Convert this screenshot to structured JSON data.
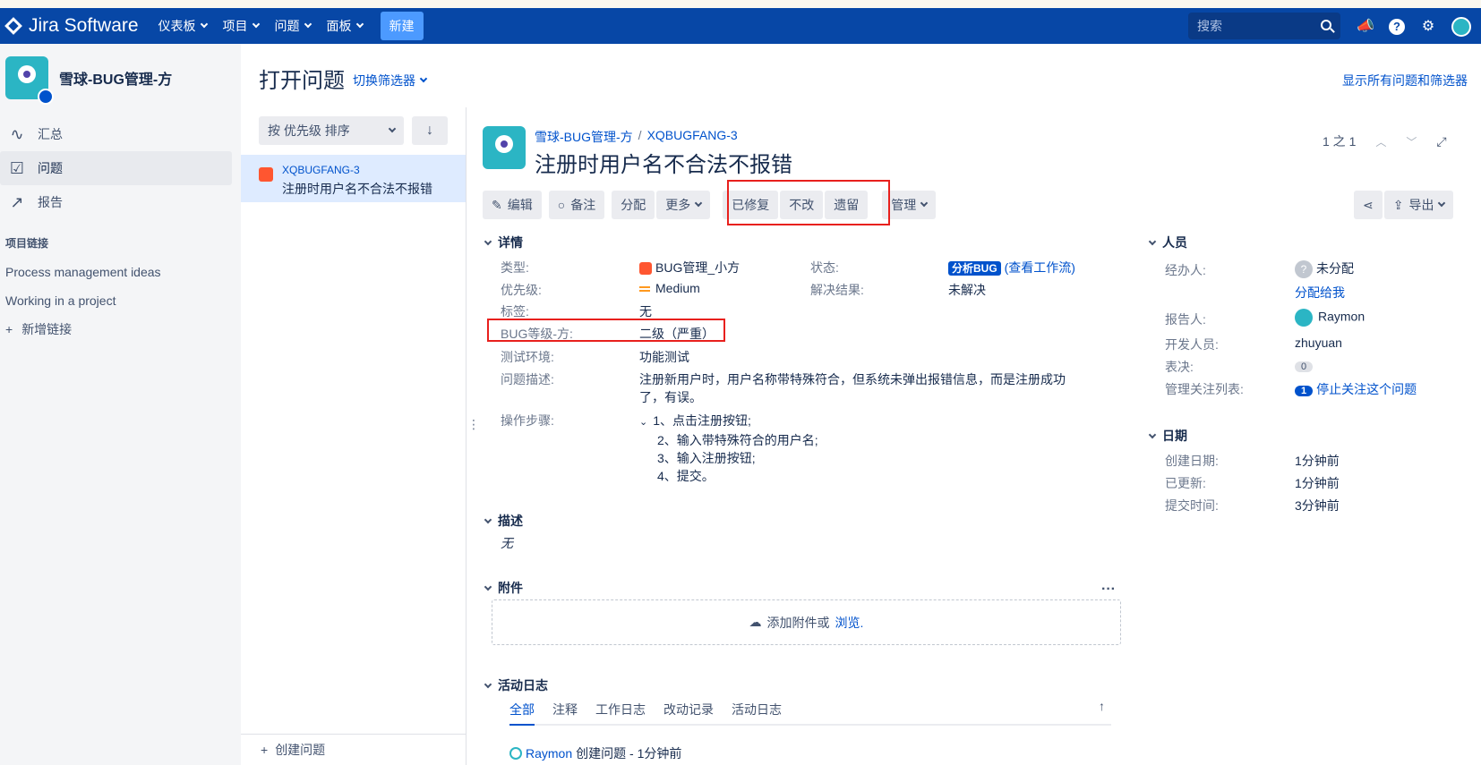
{
  "topbar": {
    "logo_text": "Jira Software",
    "menu": [
      "仪表板",
      "项目",
      "问题",
      "面板"
    ],
    "create_label": "新建",
    "search_placeholder": "搜索"
  },
  "sidebar": {
    "project_name": "雪球-BUG管理-方",
    "items": [
      {
        "label": "汇总",
        "icon": "pulse-icon"
      },
      {
        "label": "问题",
        "icon": "issues-icon"
      },
      {
        "label": "报告",
        "icon": "chart-icon"
      }
    ],
    "section_title": "项目链接",
    "links": [
      "Process management ideas",
      "Working in a project"
    ],
    "add_link": "新增链接"
  },
  "header": {
    "title": "打开问题",
    "switch_filter": "切换筛选器",
    "show_all": "显示所有问题和筛选器"
  },
  "list": {
    "sort_label": "按 优先级 排序",
    "sort_dir": "↓",
    "item_key": "XQBUGFANG-3",
    "item_summary": "注册时用户名不合法不报错",
    "create_issue": "创建问题"
  },
  "issue": {
    "project": "雪球-BUG管理-方",
    "key": "XQBUGFANG-3",
    "title": "注册时用户名不合法不报错",
    "pager": "1 之 1",
    "toolbar": {
      "edit": "编辑",
      "comment": "备注",
      "assign": "分配",
      "more": "更多",
      "fixed": "已修复",
      "wontfix": "不改",
      "deferred": "遗留",
      "manage": "管理",
      "export": "导出"
    },
    "details_title": "详情",
    "fields": {
      "type_label": "类型:",
      "type_value": "BUG管理_小方",
      "status_label": "状态:",
      "status_value": "分析BUG",
      "status_link": "(查看工作流)",
      "priority_label": "优先级:",
      "priority_value": "Medium",
      "resolution_label": "解决结果:",
      "resolution_value": "未解决",
      "labels_label": "标签:",
      "labels_value": "无",
      "bug_level_label": "BUG等级-方:",
      "bug_level_value": "二级（严重）",
      "env_label": "测试环境:",
      "env_value": "功能测试",
      "desc_label": "问题描述:",
      "desc_value": "注册新用户时，用户名称带特殊符合，但系统未弹出报错信息，而是注册成功了，有误。",
      "steps_label": "操作步骤:",
      "steps": [
        "1、点击注册按钮;",
        "2、输入带特殊符合的用户名;",
        "3、输入注册按钮;",
        "4、提交。"
      ]
    },
    "description_title": "描述",
    "description_value": "无",
    "attachments_title": "附件",
    "attach_text": "添加附件或",
    "attach_browse": "浏览.",
    "activity_title": "活动日志",
    "activity_tabs": [
      "全部",
      "注释",
      "工作日志",
      "改动记录",
      "活动日志"
    ],
    "activity_user": "Raymon",
    "activity_text": "创建问题 - 1分钟前"
  },
  "people": {
    "title": "人员",
    "assignee_label": "经办人:",
    "assignee_value": "未分配",
    "assign_to_me": "分配给我",
    "reporter_label": "报告人:",
    "reporter_value": "Raymon",
    "developer_label": "开发人员:",
    "developer_value": "zhuyuan",
    "votes_label": "表决:",
    "votes_value": "0",
    "watchers_label": "管理关注列表:",
    "watchers_count": "1",
    "watchers_action": "停止关注这个问题"
  },
  "dates": {
    "title": "日期",
    "created_label": "创建日期:",
    "created_value": "1分钟前",
    "updated_label": "已更新:",
    "updated_value": "1分钟前",
    "submitted_label": "提交时间:",
    "submitted_value": "3分钟前"
  },
  "colors": {
    "topbar": "#0747a6",
    "link": "#0052cc",
    "highlight": "#e8201d",
    "bug": "#ff5630"
  }
}
